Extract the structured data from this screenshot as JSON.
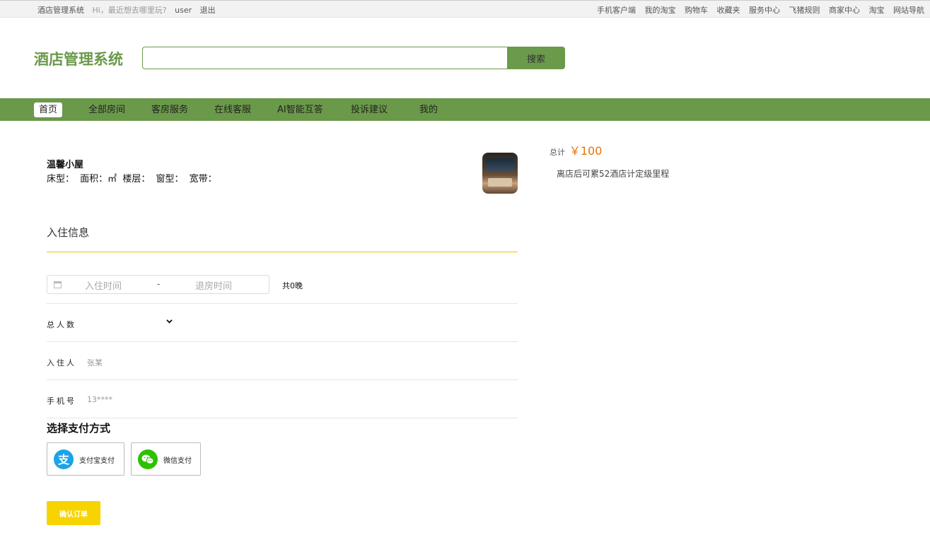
{
  "topbar": {
    "site": "酒店管理系统",
    "greeting": "Hi，最近想去哪里玩?",
    "user": "user",
    "logout": "退出",
    "links": [
      "手机客户端",
      "我的淘宝",
      "购物车",
      "收藏夹",
      "服务中心",
      "飞猪规则",
      "商家中心",
      "淘宝",
      "网站导航"
    ]
  },
  "header": {
    "logo": "酒店管理系统",
    "search_value": "",
    "search_button": "搜索"
  },
  "nav": [
    "首页",
    "全部房间",
    "客房服务",
    "在线客服",
    "AI智能互答",
    "投诉建议",
    "我的"
  ],
  "room": {
    "name": "温馨小屋",
    "bed": "床型：",
    "area": "面积：㎡",
    "floor": "楼层：",
    "window": "窗型：",
    "wifi": "宽带："
  },
  "checkin": {
    "title": "入住信息",
    "checkin_placeholder": "入住时间",
    "separator": "-",
    "checkout_placeholder": "退房时间",
    "nights": "共0晚",
    "guests_label": "总人数",
    "guest_name_label": "入住人",
    "guest_name_placeholder": "张某",
    "phone_label": "手机号",
    "phone_placeholder": "13****"
  },
  "payment": {
    "title": "选择支付方式",
    "alipay": "支付宝支付",
    "wechat": "微信支付",
    "alipay_color": "#1aa3e8",
    "wechat_color": "#2dc100"
  },
  "confirm_button": "确认订单",
  "summary": {
    "total_label": "总计",
    "total_amount": "￥100",
    "points_note": "离店后可累52酒店计定级里程"
  }
}
